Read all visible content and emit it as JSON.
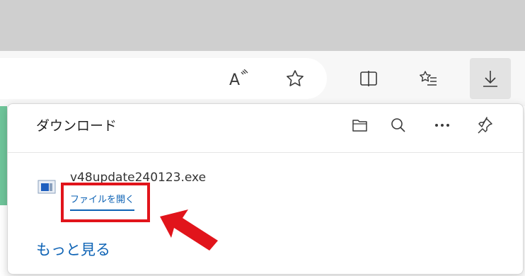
{
  "toolbar": {
    "read_aloud_icon": "read-aloud-icon",
    "favorite_icon": "favorite-star-icon",
    "split_screen_icon": "split-screen-icon",
    "favorites_icon": "favorites-list-icon",
    "downloads_icon": "download-icon"
  },
  "downloads_panel": {
    "title": "ダウンロード",
    "header_icons": [
      "open-folder-icon",
      "search-icon",
      "more-options-icon",
      "pin-icon"
    ],
    "items": [
      {
        "file_name": "v48update240123.exe",
        "action_label": "ファイルを開く",
        "icon": "exe-file-icon"
      }
    ],
    "more_link": "もっと見る"
  },
  "annotation": {
    "highlight_color": "#e1141b",
    "arrow_color": "#e1141b"
  },
  "colors": {
    "link": "#0e63b5",
    "tabstrip": "#cfcfcf",
    "toolbar": "#f7f7f7"
  }
}
